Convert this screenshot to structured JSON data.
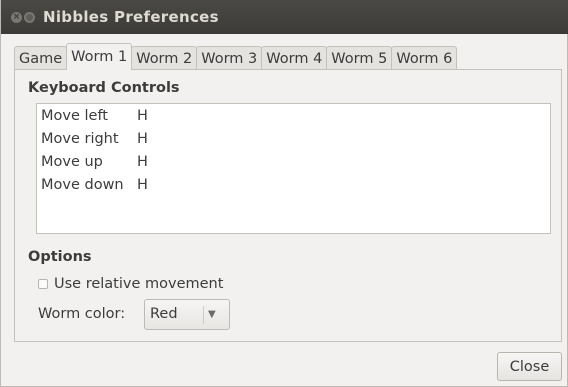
{
  "window": {
    "title": "Nibbles Preferences",
    "titlebar_color": "#3c3b37"
  },
  "tabs": [
    {
      "label": "Game",
      "active": false
    },
    {
      "label": "Worm 1",
      "active": true
    },
    {
      "label": "Worm 2",
      "active": false
    },
    {
      "label": "Worm 3",
      "active": false
    },
    {
      "label": "Worm 4",
      "active": false
    },
    {
      "label": "Worm 5",
      "active": false
    },
    {
      "label": "Worm 6",
      "active": false
    }
  ],
  "keyboard": {
    "heading": "Keyboard Controls",
    "rows": [
      {
        "action": "Move left",
        "key": "H"
      },
      {
        "action": "Move right",
        "key": "H"
      },
      {
        "action": "Move up",
        "key": "H"
      },
      {
        "action": "Move down",
        "key": "H"
      }
    ]
  },
  "options": {
    "heading": "Options",
    "relative_movement_label": "Use relative movement",
    "relative_movement_checked": false,
    "worm_color_label": "Worm color:",
    "worm_color_value": "Red"
  },
  "buttons": {
    "close_label": "Close"
  }
}
